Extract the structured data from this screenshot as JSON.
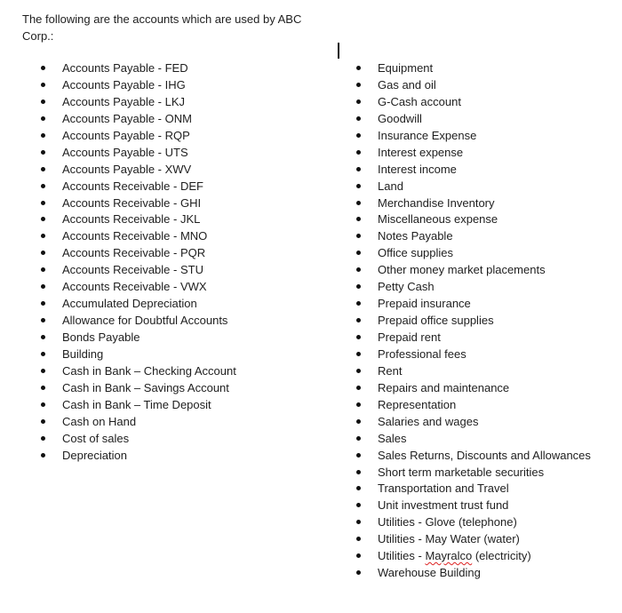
{
  "document": {
    "intro": "The following are the accounts which are used by ABC Corp.:",
    "left_column": [
      "Accounts Payable - FED",
      "Accounts Payable - IHG",
      "Accounts Payable - LKJ",
      "Accounts Payable - ONM",
      "Accounts Payable - RQP",
      "Accounts Payable - UTS",
      "Accounts Payable - XWV",
      "Accounts Receivable - DEF",
      "Accounts Receivable - GHI",
      "Accounts Receivable - JKL",
      "Accounts Receivable - MNO",
      "Accounts Receivable - PQR",
      "Accounts Receivable - STU",
      "Accounts Receivable - VWX",
      "Accumulated Depreciation",
      "Allowance for Doubtful Accounts",
      "Bonds Payable",
      "Building",
      "Cash in Bank – Checking Account",
      "Cash in Bank – Savings Account",
      "Cash in Bank – Time Deposit",
      "Cash on Hand",
      "Cost of sales",
      "Depreciation"
    ],
    "right_column": [
      "Equipment",
      "Gas and oil",
      "G-Cash account",
      "Goodwill",
      "Insurance Expense",
      "Interest expense",
      "Interest income",
      "Land",
      "Merchandise Inventory",
      "Miscellaneous expense",
      "Notes Payable",
      "Office supplies",
      "Other money market placements",
      "Petty Cash",
      "Prepaid insurance",
      "Prepaid office supplies",
      "Prepaid rent",
      "Professional fees",
      "Rent",
      "Repairs and maintenance",
      "Representation",
      "Salaries and wages",
      "Sales",
      "Sales Returns, Discounts and Allowances",
      "Short term marketable securities",
      "Transportation and Travel",
      "Unit investment trust fund",
      "Utilities - Glove (telephone)",
      "Utilities - May Water (water)",
      "Utilities - Mayralco (electricity)",
      "Warehouse Building"
    ],
    "misspelled_word": "Mayralco"
  }
}
